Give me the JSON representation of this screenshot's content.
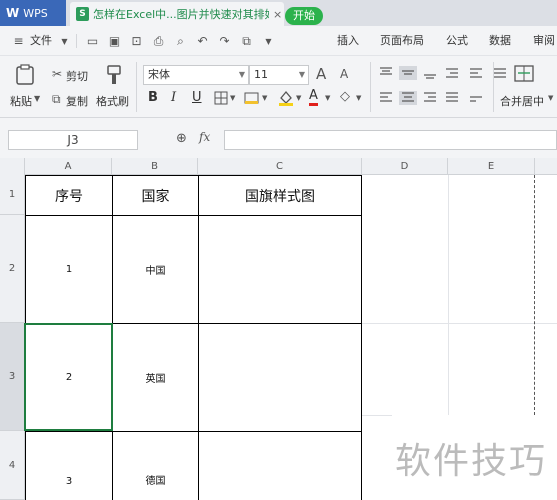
{
  "titlebar": {
    "app_name": "WPS",
    "doc_tab_title": "怎样在Excel中...图片并快速对其排好",
    "close": "×",
    "new_tab": "+"
  },
  "menu": {
    "file_label": "文件",
    "start_label": "开始",
    "items": [
      "插入",
      "页面布局",
      "公式",
      "数据",
      "审阅"
    ]
  },
  "ribbon": {
    "paste": "粘贴",
    "cut": "剪切",
    "copy": "复制",
    "format_painter": "格式刷",
    "font_name": "宋体",
    "font_size": "11",
    "bold": "B",
    "italic": "I",
    "underline": "U",
    "grow_font": "A",
    "shrink_font": "A",
    "font_color": "A",
    "merge_center": "合并居中"
  },
  "formula_bar": {
    "cell_ref": "J3",
    "fx": "fx"
  },
  "grid": {
    "columns": [
      "A",
      "B",
      "C",
      "D",
      "E"
    ],
    "rows": [
      "1",
      "2",
      "3",
      "4"
    ],
    "header": {
      "a": "序号",
      "b": "国家",
      "c": "国旗样式图"
    },
    "data": [
      {
        "no": "1",
        "country": "中国"
      },
      {
        "no": "2",
        "country": "英国"
      },
      {
        "no": "3",
        "country": "德国"
      }
    ]
  },
  "watermark": "软件技巧"
}
